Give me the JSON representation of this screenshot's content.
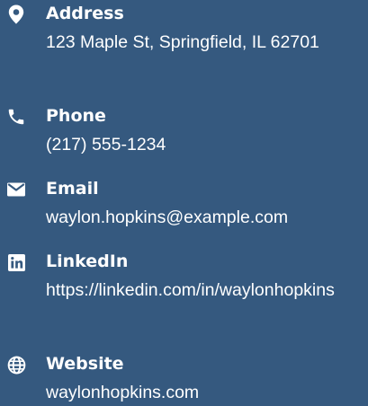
{
  "contacts": [
    {
      "label": "Address",
      "value": "123 Maple St, Springfield, IL 62701",
      "icon": "map-pin-icon"
    },
    {
      "label": "Phone",
      "value": "(217) 555-1234",
      "icon": "phone-icon"
    },
    {
      "label": "Email",
      "value": "waylon.hopkins@example.com",
      "icon": "envelope-icon"
    },
    {
      "label": "LinkedIn",
      "value": "https://linkedin.com/in/waylonhopkins",
      "icon": "linkedin-icon"
    },
    {
      "label": "Website",
      "value": "waylonhopkins.com",
      "icon": "globe-icon"
    }
  ],
  "colors": {
    "background": "#35597f",
    "text": "#ffffff"
  }
}
